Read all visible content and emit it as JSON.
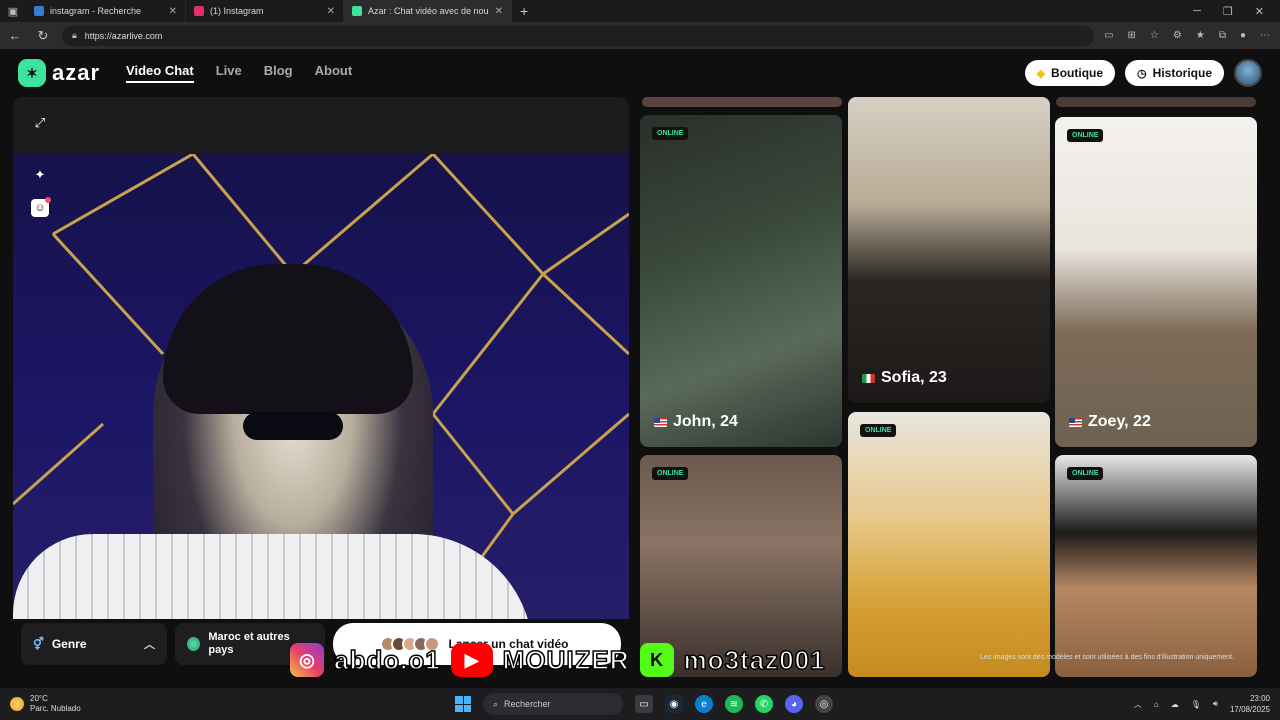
{
  "browser": {
    "tabs": [
      {
        "title": "instagram - Recherche",
        "favicon_color": "#3a7bd5",
        "active": false
      },
      {
        "title": "(1) Instagram",
        "favicon_color": "#e1306c",
        "active": false
      },
      {
        "title": "Azar : Chat vidéo avec de nou",
        "favicon_color": "#3ce39d",
        "active": true
      }
    ],
    "url": "https://azarlive.com"
  },
  "site": {
    "logo_text": "azar",
    "nav": [
      "Video Chat",
      "Live",
      "Blog",
      "About"
    ],
    "active_nav": "Video Chat",
    "boutique_label": "Boutique",
    "historique_label": "Historique"
  },
  "controls": {
    "genre_label": "Genre",
    "country_label": "Maroc et autres pays",
    "start_label": "Lancer un chat vidéo"
  },
  "profiles": [
    {
      "name": "John, 24",
      "flag": "us",
      "online": "ONLINE",
      "bg": "linear-gradient(160deg,#2a2f2a 0%,#3a4a3c 40%,#5a6a5a 70%,#2b3530 100%)"
    },
    {
      "name": "Sofia, 23",
      "flag": "it",
      "online": "",
      "bg": "linear-gradient(180deg,#d7d0c4 0%,#b9ab95 35%,#2a2624 60%,#1c1918 100%)"
    },
    {
      "name": "Zoey, 22",
      "flag": "us",
      "online": "ONLINE",
      "bg": "linear-gradient(180deg,#f4f2ee 0%,#e9e4dd 40%,#7d6a57 65%,#6e6252 100%)"
    },
    {
      "name": "",
      "flag": "",
      "online": "ONLINE",
      "bg": "linear-gradient(180deg,#6b5a4e 0%,#8a7464 40%,#3a302c 100%)"
    },
    {
      "name": "",
      "flag": "",
      "online": "ONLINE",
      "bg": "linear-gradient(180deg,#e8e6de 0%,#e9c88a 40%,#d8a33a 70%,#c48a20 100%)"
    },
    {
      "name": "",
      "flag": "",
      "online": "ONLINE",
      "bg": "linear-gradient(180deg,#e8e8e6 0%,#1d1a1a 35%,#b58862 60%,#8a6040 100%)"
    }
  ],
  "disclaimer": "Les images sont des modèles et sont utilisées à des fins d'illustration uniquement.",
  "overlay": {
    "instagram": "abdo.o1",
    "youtube": "MOUIZER",
    "kick": "mo3taz001"
  },
  "taskbar": {
    "temp": "20°C",
    "weather": "Parc. Nublado",
    "search": "Rechercher",
    "time": "23:00",
    "date": "17/08/2025"
  }
}
